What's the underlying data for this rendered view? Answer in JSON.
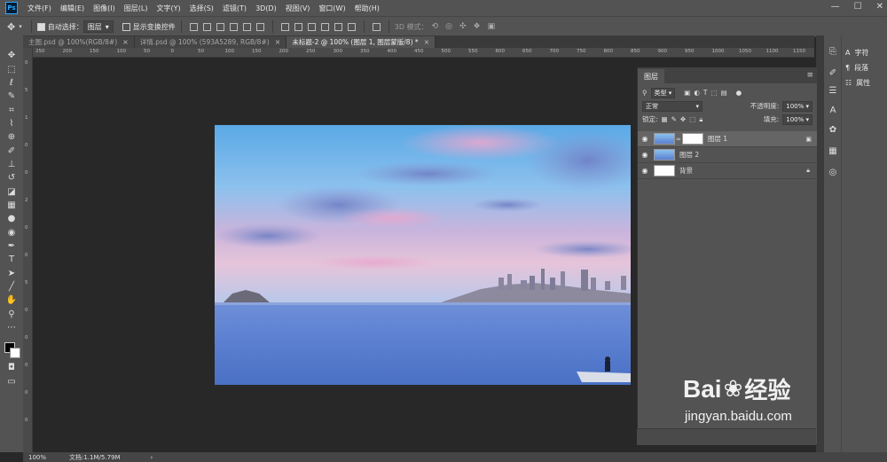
{
  "menu": {
    "items": [
      "文件(F)",
      "编辑(E)",
      "图像(I)",
      "图层(L)",
      "文字(Y)",
      "选择(S)",
      "滤镜(T)",
      "3D(D)",
      "视图(V)",
      "窗口(W)",
      "帮助(H)"
    ],
    "window_controls": [
      "—",
      "☐",
      "✕"
    ]
  },
  "options_bar": {
    "auto_select_label": "自动选择：",
    "auto_select_value": "图层",
    "show_transform_label": "显示变换控件",
    "mode_3d_label": "3D 模式："
  },
  "tabs": [
    {
      "label": "主图.psd @ 100%(RGB/8#)",
      "close": "×",
      "active": false
    },
    {
      "label": "详情.psd @ 100% (593A5289, RGB/8#)",
      "close": "×",
      "active": false
    },
    {
      "label": "未标题-2 @ 100% (图层 1, 图层蒙版/8) *",
      "close": "×",
      "active": true
    }
  ],
  "ruler_h": [
    "250",
    "200",
    "150",
    "100",
    "50",
    "0",
    "50",
    "100",
    "150",
    "200",
    "250",
    "300",
    "350",
    "400",
    "450",
    "500",
    "550",
    "600",
    "650",
    "700",
    "750",
    "800",
    "850",
    "900",
    "950",
    "1000",
    "1050",
    "1100",
    "1150"
  ],
  "ruler_v": [
    "0",
    "5",
    "1",
    "0",
    "0",
    "2",
    "0",
    "0",
    "5",
    "0",
    "0",
    "0",
    "0",
    "0"
  ],
  "layers_panel": {
    "tab_label": "图层",
    "filter_value": "类型",
    "blend_mode": "正常",
    "opacity_label": "不透明度:",
    "opacity_value": "100%",
    "lock_label": "锁定:",
    "fill_label": "填充:",
    "fill_value": "100%",
    "layers": [
      {
        "name": "图层 1",
        "selected": true
      },
      {
        "name": "图层 2",
        "selected": false
      },
      {
        "name": "背景",
        "selected": false
      }
    ]
  },
  "right_panel": {
    "items": [
      {
        "label": "字符",
        "icon": "character-icon"
      },
      {
        "label": "段落",
        "icon": "paragraph-icon"
      },
      {
        "label": "属性",
        "icon": "properties-icon"
      }
    ]
  },
  "status": {
    "zoom": "100%",
    "doc_info": "文档:1.1M/5.79M",
    "arrow": "›"
  },
  "watermark": {
    "brand": "Bai",
    "brand2": "经验",
    "url": "jingyan.baidu.com"
  },
  "colors": {
    "accent": "#31a8ff",
    "panel": "#535353",
    "canvas_bg": "#282828"
  }
}
